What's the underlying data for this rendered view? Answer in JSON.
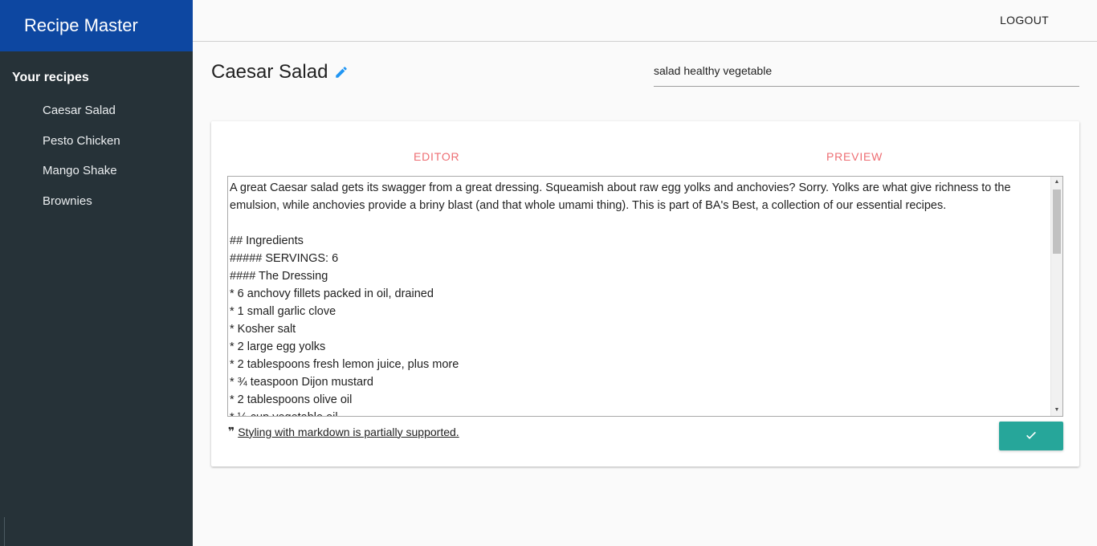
{
  "app": {
    "title": "Recipe Master"
  },
  "sidebar": {
    "heading": "Your recipes",
    "items": [
      {
        "label": "Caesar Salad"
      },
      {
        "label": "Pesto Chicken"
      },
      {
        "label": "Mango Shake"
      },
      {
        "label": "Brownies"
      }
    ]
  },
  "header": {
    "logout_label": "LOGOUT"
  },
  "recipe": {
    "title": "Caesar Salad",
    "tags": "salad healthy vegetable"
  },
  "tabs": {
    "editor_label": "EDITOR",
    "preview_label": "PREVIEW"
  },
  "editor": {
    "content": "A great Caesar salad gets its swagger from a great dressing. Squeamish about raw egg yolks and anchovies? Sorry. Yolks are what give richness to the emulsion, while anchovies provide a briny blast (and that whole umami thing). This is part of BA's Best, a collection of our essential recipes.\n\n## Ingredients\n##### SERVINGS: 6\n#### The Dressing\n* 6 anchovy fillets packed in oil, drained\n* 1 small garlic clove\n* Kosher salt\n* 2 large egg yolks\n* 2 tablespoons fresh lemon juice, plus more\n* ¾ teaspoon Dijon mustard\n* 2 tablespoons olive oil\n* ½ cup vegetable oil"
  },
  "footer": {
    "quote_glyph": "❞",
    "markdown_note": " Styling with markdown is partially supported."
  },
  "colors": {
    "brand": "#0d47a1",
    "sidebar": "#263238",
    "accent_tab": "#ee6e73",
    "save_button": "#26a69a",
    "edit_icon": "#2196f3"
  },
  "icons": {
    "edit": "pencil-icon",
    "save": "check-icon",
    "quote": "quote-icon"
  }
}
